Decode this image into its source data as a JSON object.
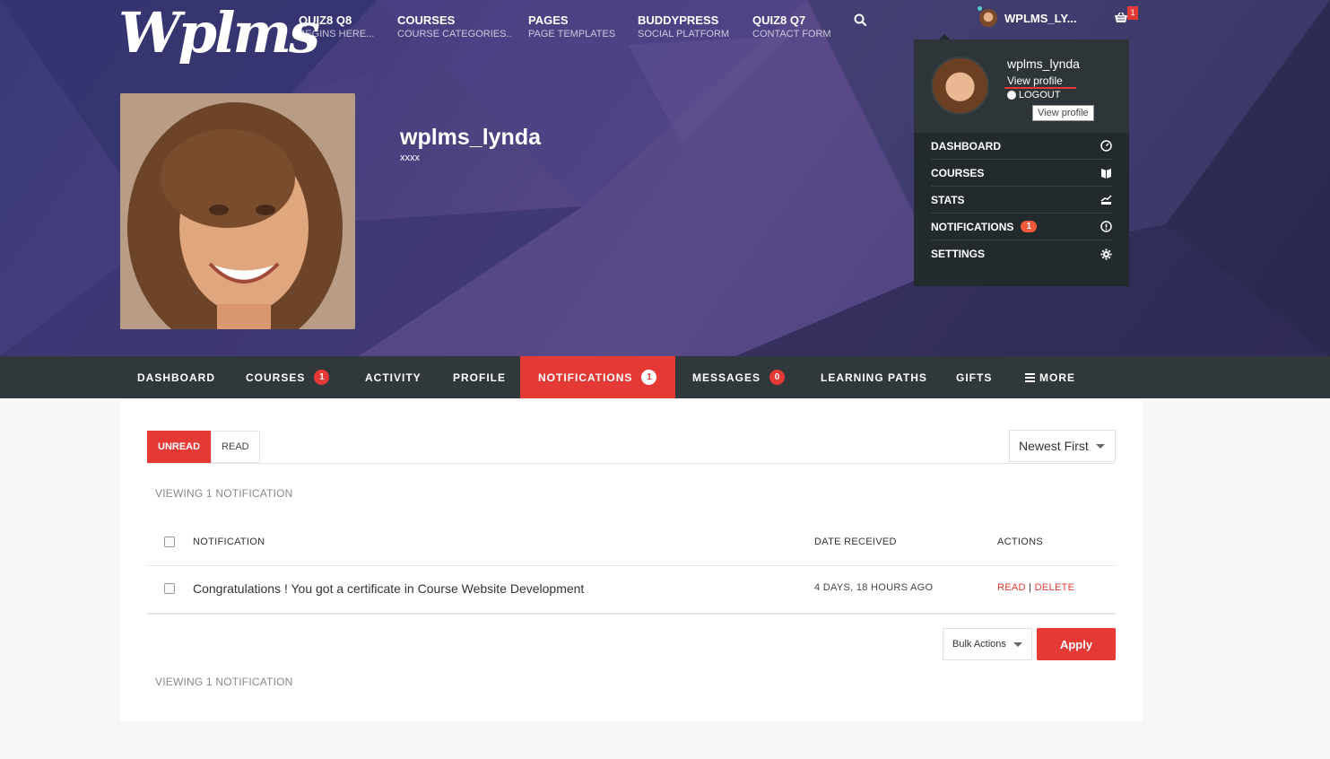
{
  "brand": {
    "logo": "Wplms"
  },
  "top_nav": [
    {
      "title": "QUIZ8 Q8",
      "sub": "BEGINS HERE..."
    },
    {
      "title": "COURSES",
      "sub": "COURSE CATEGORIES.."
    },
    {
      "title": "PAGES",
      "sub": "PAGE TEMPLATES"
    },
    {
      "title": "BUDDYPRESS",
      "sub": "SOCIAL PLATFORM"
    },
    {
      "title": "QUIZ8 Q7",
      "sub": "CONTACT FORM"
    }
  ],
  "user": {
    "short_name": "WPLMS_LY...",
    "cart_count": "1"
  },
  "profile": {
    "name": "wplms_lynda",
    "subtitle": "xxxx"
  },
  "dropdown": {
    "username": "wplms_lynda",
    "view_profile": "View profile",
    "logout": "LOGOUT",
    "tooltip": "View profile",
    "menu": [
      {
        "label": "DASHBOARD",
        "icon": "dashboard-icon"
      },
      {
        "label": "COURSES",
        "icon": "book-icon"
      },
      {
        "label": "STATS",
        "icon": "stats-icon"
      },
      {
        "label": "NOTIFICATIONS",
        "icon": "alert-icon",
        "badge": "1"
      },
      {
        "label": "SETTINGS",
        "icon": "gear-icon"
      }
    ]
  },
  "subnav": {
    "dashboard": "DASHBOARD",
    "courses": "COURSES",
    "courses_badge": "1",
    "activity": "ACTIVITY",
    "profile": "PROFILE",
    "notifications": "NOTIFICATIONS",
    "notifications_badge": "1",
    "messages": "MESSAGES",
    "messages_badge": "0",
    "learning_paths": "LEARNING PATHS",
    "gifts": "GIFTS",
    "more": "MORE"
  },
  "notifications": {
    "tabs": {
      "unread": "UNREAD",
      "read": "READ"
    },
    "sort": "Newest First",
    "viewing": "VIEWING 1 NOTIFICATION",
    "columns": {
      "notification": "NOTIFICATION",
      "date": "DATE RECEIVED",
      "actions": "ACTIONS"
    },
    "rows": [
      {
        "text": "Congratulations ! You got a certificate in Course Website Development",
        "date": "4 DAYS, 18 HOURS AGO",
        "read": "READ",
        "sep": "|",
        "delete": "DELETE"
      }
    ],
    "bulk_actions": "Bulk Actions",
    "apply": "Apply"
  },
  "colors": {
    "accent": "#e53935",
    "nav_bg": "#30383b",
    "dropdown_bg": "#232a2d"
  }
}
